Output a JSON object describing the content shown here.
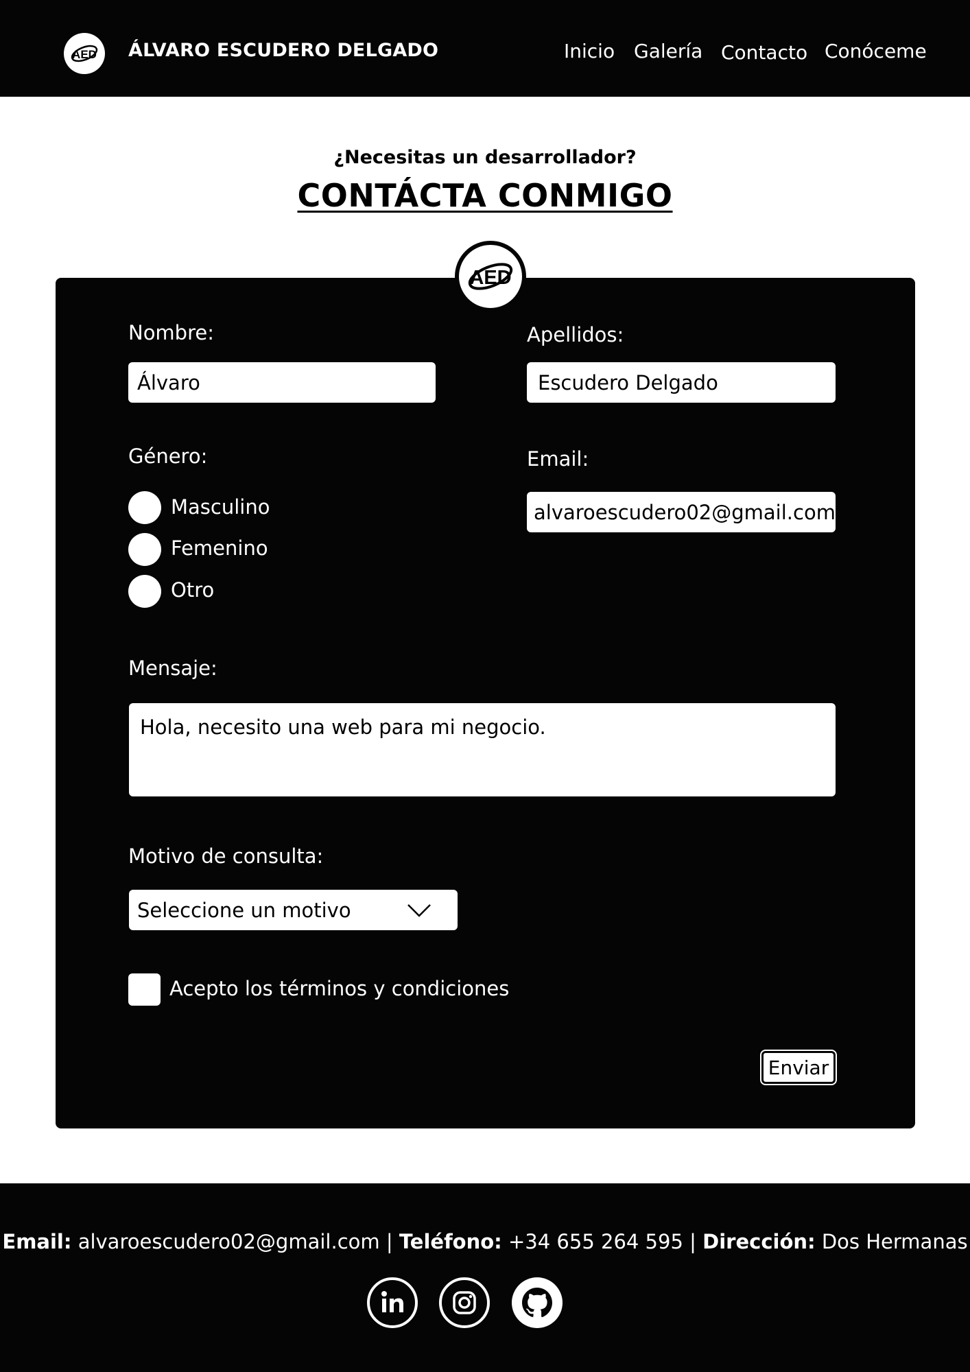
{
  "header": {
    "logo_text": "AED",
    "brand": "ÁLVARO ESCUDERO DELGADO",
    "nav": [
      "Inicio",
      "Galería",
      "Contacto",
      "Conóceme"
    ]
  },
  "hero": {
    "subtitle": "¿Necesitas un desarrollador?",
    "title": "CONTÁCTA CONMIGO"
  },
  "form": {
    "logo_text": "AED",
    "nombre_label": "Nombre:",
    "nombre_value": "Álvaro",
    "apellidos_label": "Apellidos:",
    "apellidos_value": "Escudero Delgado",
    "genero_label": "Género:",
    "genero_options": [
      "Masculino",
      "Femenino",
      "Otro"
    ],
    "email_label": "Email:",
    "email_value": "alvaroescudero02@gmail.com",
    "mensaje_label": "Mensaje:",
    "mensaje_value": "Hola, necesito una web para mi negocio.",
    "motivo_label": "Motivo de consulta:",
    "motivo_selected": "Seleccione un motivo",
    "terms_label": "Acepto los términos y condiciones",
    "submit_label": "Enviar"
  },
  "footer": {
    "email_label": "Email:",
    "email_value": "alvaroescudero02@gmail.com",
    "separator": "|",
    "phone_label": "Teléfono:",
    "phone_value": "+34 655 264 595",
    "address_label": "Dirección:",
    "address_value": "Dos Hermanas",
    "social_icons": [
      "linkedin-icon",
      "instagram-icon",
      "github-icon"
    ]
  },
  "colors": {
    "background": "#ffffff",
    "dark": "#050505",
    "light": "#ffffff"
  }
}
